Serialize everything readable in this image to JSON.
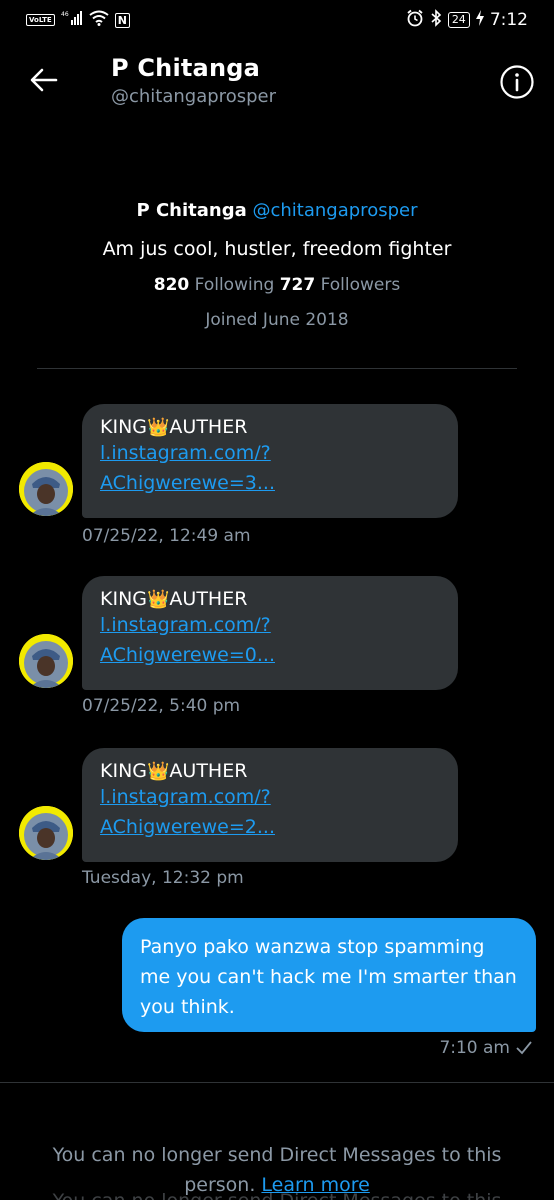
{
  "status_bar": {
    "left_badge": "VoLTE",
    "signal_label": "46",
    "nfc": "N",
    "battery": "24",
    "time": "7:12"
  },
  "header": {
    "name": "P Chitanga",
    "handle": "@chitangaprosper"
  },
  "profile": {
    "name": "P Chitanga",
    "handle": "@chitangaprosper",
    "bio": "Am jus cool, hustler, freedom fighter",
    "following_count": "820",
    "following_label": "Following",
    "followers_count": "727",
    "followers_label": "Followers",
    "joined": "Joined June 2018"
  },
  "messages": [
    {
      "sender": "KING",
      "sender_suffix": "AUTHER",
      "crown": "👑",
      "link_line1": "l.instagram.com/?",
      "link_line2": "AChigwerewe=3...",
      "time": "07/25/22, 12:49 am"
    },
    {
      "sender": "KING",
      "sender_suffix": "AUTHER",
      "crown": "👑",
      "link_line1": "l.instagram.com/?",
      "link_line2": "AChigwerewe=0...",
      "time": "07/25/22, 5:40 pm"
    },
    {
      "sender": "KING",
      "sender_suffix": "AUTHER",
      "crown": "👑",
      "link_line1": "l.instagram.com/?",
      "link_line2": "AChigwerewe=2...",
      "time": "Tuesday, 12:32 pm"
    }
  ],
  "sent_message": {
    "text": "Panyo pako wanzwa stop spamming me you can't hack me I'm smarter than you think.",
    "time": "7:10 am",
    "status_icon": "check-icon"
  },
  "footer": {
    "notice": "You can no longer send Direct Messages to this person.",
    "link": "Learn more",
    "ghost": "You can no longer send Direct Messages to this"
  },
  "colors": {
    "accent": "#1d9bf0",
    "bubble": "#2f3336",
    "secondary_text": "#8b98a5",
    "background": "#000000"
  }
}
